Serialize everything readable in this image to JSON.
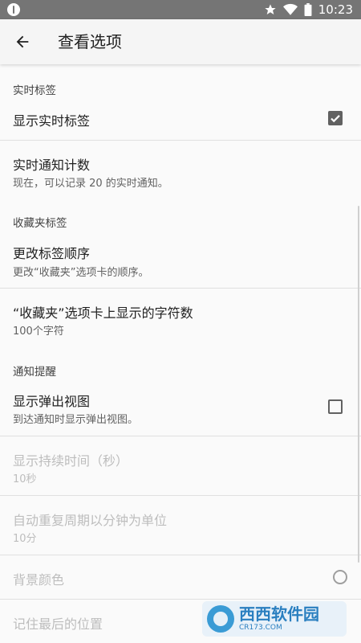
{
  "status_bar": {
    "time": "10:23",
    "icons": [
      "star-icon",
      "wifi-icon",
      "battery-icon"
    ]
  },
  "app_bar": {
    "title": "查看选项",
    "back_icon": "arrow-back-icon"
  },
  "sections": {
    "realtime": {
      "header": "实时标签",
      "show_realtime": {
        "title": "显示实时标签",
        "checked": true
      },
      "notify_count": {
        "title": "实时通知计数",
        "summary": "现在，可以记录 20 的实时通知。"
      }
    },
    "favorites": {
      "header": "收藏夹标签",
      "change_order": {
        "title": "更改标签顺序",
        "summary": "更改“收藏夹”选项卡的顺序。"
      },
      "char_count": {
        "title": "“收藏夹”选项卡上显示的字符数",
        "summary": "100个字符"
      }
    },
    "notification": {
      "header": "通知提醒",
      "popup": {
        "title": "显示弹出视图",
        "summary": "到达通知时显示弹出视图。",
        "checked": false
      },
      "duration": {
        "title": "显示持续时间（秒）",
        "summary": "10秒"
      },
      "repeat": {
        "title": "自动重复周期以分钟为单位",
        "summary": "10分"
      },
      "bg_color": {
        "title": "背景颜色"
      },
      "remember_pos": {
        "title": "记住最后的位置"
      }
    }
  },
  "watermark": {
    "main": "西西软件园",
    "sub": "CR173.COM"
  },
  "colors": {
    "status_bar": "#757575",
    "app_bar": "#f5f5f5",
    "background": "#fafafa",
    "control": "#616161",
    "disabled_text": "#bdbdbd"
  }
}
